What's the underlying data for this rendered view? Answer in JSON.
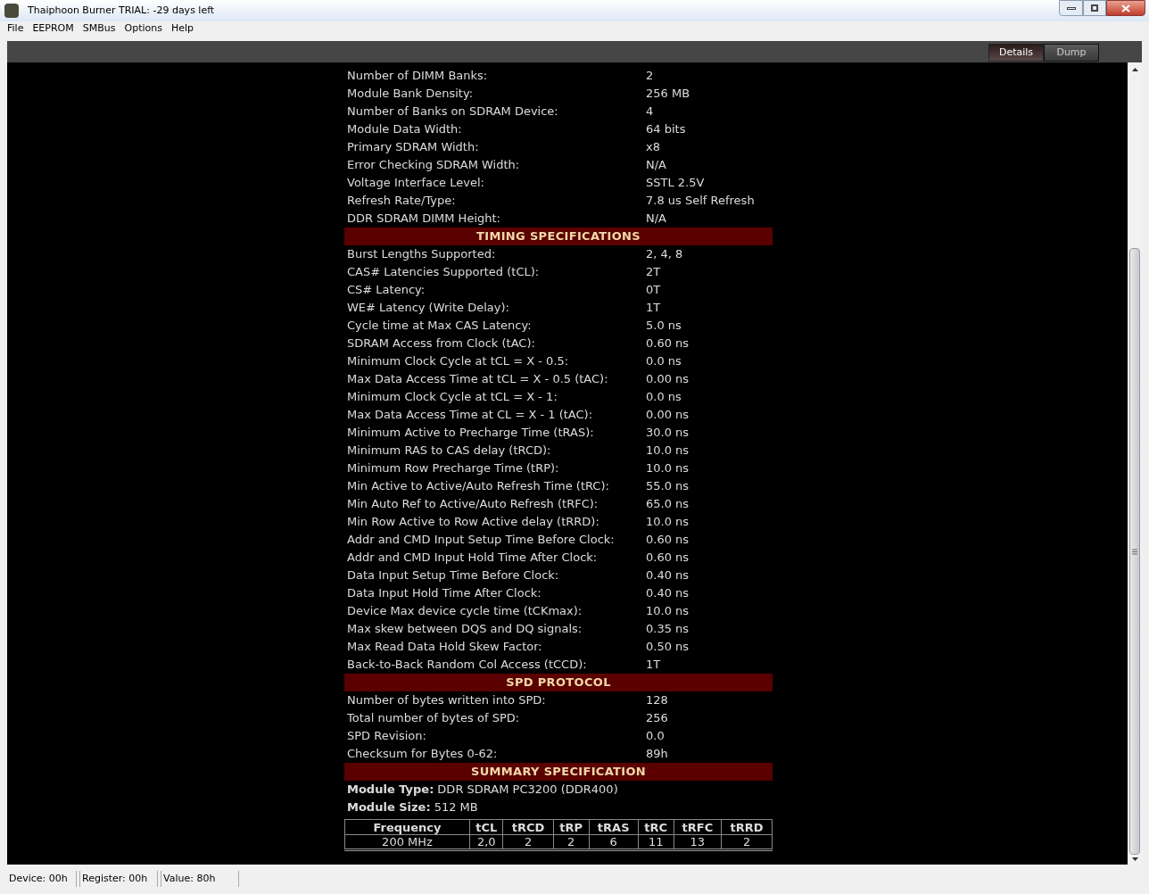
{
  "window": {
    "title": "Thaiphoon Burner TRIAL:  -29 days left"
  },
  "menu": [
    "File",
    "EEPROM",
    "SMBus",
    "Options",
    "Help"
  ],
  "tabs": [
    {
      "label": "Details",
      "selected": true
    },
    {
      "label": "Dump",
      "selected": false
    }
  ],
  "sections": [
    {
      "rows": [
        [
          "Number of DIMM Banks:",
          "2"
        ],
        [
          "Module Bank Density:",
          "256 MB"
        ],
        [
          "Number of Banks on SDRAM Device:",
          "4"
        ],
        [
          "Module Data Width:",
          "64 bits"
        ],
        [
          "Primary SDRAM Width:",
          "x8"
        ],
        [
          "Error Checking SDRAM Width:",
          "N/A"
        ],
        [
          "Voltage Interface Level:",
          "SSTL 2.5V"
        ],
        [
          "Refresh Rate/Type:",
          "7.8 us Self Refresh"
        ],
        [
          "DDR SDRAM DIMM Height:",
          "N/A"
        ]
      ]
    },
    {
      "title": "TIMING SPECIFICATIONS",
      "rows": [
        [
          "Burst Lengths Supported:",
          "2, 4, 8"
        ],
        [
          "CAS# Latencies Supported (tCL):",
          "2T"
        ],
        [
          "CS# Latency:",
          "0T"
        ],
        [
          "WE# Latency (Write Delay):",
          "1T"
        ],
        [
          "Cycle time at Max CAS Latency:",
          "5.0 ns"
        ],
        [
          "SDRAM Access from Clock (tAC):",
          "0.60 ns"
        ],
        [
          "Minimum Clock Cycle at tCL = X - 0.5:",
          "0.0 ns"
        ],
        [
          "Max Data Access Time at tCL = X - 0.5 (tAC):",
          "0.00 ns"
        ],
        [
          "Minimum Clock Cycle at tCL = X - 1:",
          "0.0 ns"
        ],
        [
          "Max Data Access Time at CL = X - 1 (tAC):",
          "0.00 ns"
        ],
        [
          "Minimum Active to Precharge Time (tRAS):",
          "30.0 ns"
        ],
        [
          "Minimum RAS to CAS delay (tRCD):",
          "10.0 ns"
        ],
        [
          "Minimum Row Precharge Time (tRP):",
          "10.0 ns"
        ],
        [
          "Min Active to Active/Auto Refresh Time (tRC):",
          "55.0 ns"
        ],
        [
          "Min Auto Ref to Active/Auto Refresh (tRFC):",
          "65.0 ns"
        ],
        [
          "Min Row Active to Row Active delay (tRRD):",
          "10.0 ns"
        ],
        [
          "Addr and CMD Input Setup Time Before Clock:",
          "0.60 ns"
        ],
        [
          "Addr and CMD Input Hold Time After Clock:",
          "0.60 ns"
        ],
        [
          "Data Input Setup Time Before Clock:",
          "0.40 ns"
        ],
        [
          "Data Input Hold Time After Clock:",
          "0.40 ns"
        ],
        [
          "Device Max device cycle time (tCKmax):",
          "10.0 ns"
        ],
        [
          "Max skew between DQS and DQ signals:",
          "0.35 ns"
        ],
        [
          "Max Read Data Hold Skew Factor:",
          "0.50 ns"
        ],
        [
          "Back-to-Back Random Col Access (tCCD):",
          "1T"
        ]
      ]
    },
    {
      "title": "SPD PROTOCOL",
      "rows": [
        [
          "Number of bytes written into SPD:",
          "128"
        ],
        [
          "Total number of bytes of SPD:",
          "256"
        ],
        [
          "SPD Revision:",
          "0.0"
        ],
        [
          "Checksum for Bytes 0-62:",
          "89h"
        ]
      ]
    }
  ],
  "summary": {
    "title": "SUMMARY SPECIFICATION",
    "lines": [
      {
        "label": "Module Type:",
        "value": "DDR SDRAM PC3200 (DDR400)"
      },
      {
        "label": "Module Size:",
        "value": "512 MB"
      }
    ],
    "table": {
      "columns": [
        "Frequency",
        "tCL",
        "tRCD",
        "tRP",
        "tRAS",
        "tRC",
        "tRFC",
        "tRRD"
      ],
      "rows": [
        [
          "200 MHz",
          "2,0",
          "2",
          "2",
          "6",
          "11",
          "13",
          "2"
        ]
      ]
    }
  },
  "status_bar": [
    "Device: 00h",
    "Register: 00h",
    "Value: 80h"
  ]
}
